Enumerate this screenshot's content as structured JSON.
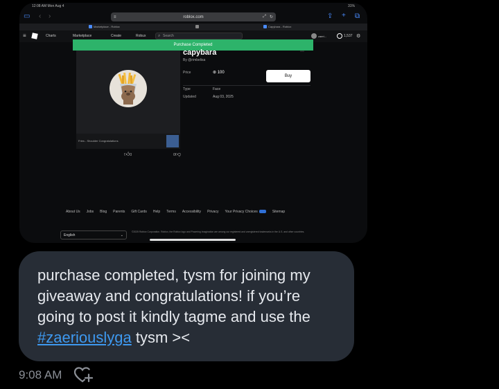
{
  "screenshot": {
    "statusbar": {
      "left": "12:08 AM  Mon Aug 4",
      "right": "31%"
    },
    "browser": {
      "url": "roblox.com",
      "tabs": [
        {
          "label": "Marketplace - Roblox"
        },
        {
          "label": ""
        },
        {
          "label": "Capybara - Roblox"
        }
      ]
    },
    "nav": {
      "items": [
        "Charts",
        "Marketplace",
        "Create",
        "Robux"
      ],
      "search_placeholder": "Search",
      "username": "zaeri...",
      "robux_balance": "1,537"
    },
    "banner": "Purchase Completed",
    "item": {
      "title": "capybara",
      "by": "By @rimbelisa",
      "price_label": "Price",
      "price_value": "100",
      "buy_label": "Buy",
      "type_label": "Type",
      "type_value": "Face",
      "updated_label": "Updated",
      "updated_value": "Aug 03, 2025",
      "thumb_caption": "Fries - Shoulder Congratulations",
      "likes": "0",
      "dislikes": "0"
    },
    "footer": {
      "links": [
        "About Us",
        "Jobs",
        "Blog",
        "Parents",
        "Gift Cards",
        "Help",
        "Terms",
        "Accessibility",
        "Privacy",
        "Your Privacy Choices",
        "Sitemap"
      ],
      "language": "English",
      "copyright": "©2025 Roblox Corporation. Roblox, the Roblox logo and Powering Imagination are among our registered and unregistered trademarks in the U.S. and other countries."
    }
  },
  "message": {
    "text_before": "purchase completed, tysm for joining my giveaway and congratulations! if you’re going to post it kindly tagme and use the ",
    "hashtag": "#zaeriouslyga",
    "text_after": " tysm ><",
    "time": "9:08 AM"
  },
  "colors": {
    "bubble": "#272d36",
    "hashtag": "#3e99f0",
    "banner": "#2db36a",
    "background": "#000000"
  },
  "icons": {
    "react": "heart-plus-icon",
    "robux": "robux-icon",
    "like": "thumbs-up-icon",
    "dislike": "thumbs-down-icon"
  }
}
